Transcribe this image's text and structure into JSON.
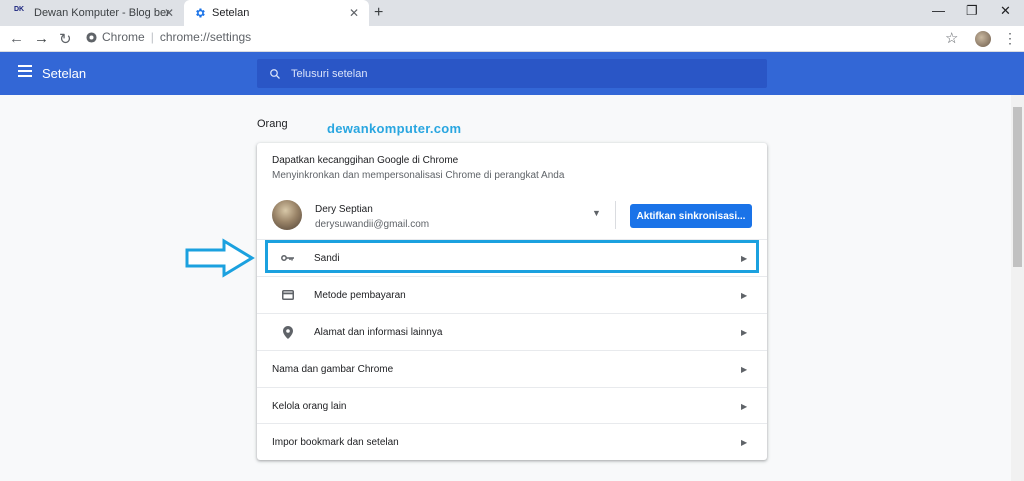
{
  "tabs": [
    {
      "favicon": "DK",
      "title": "Dewan Komputer - Blog berisi tu",
      "close": "✕"
    },
    {
      "favicon": "gear-icon",
      "title": "Setelan",
      "close": "✕"
    }
  ],
  "new_tab": "+",
  "window_controls": {
    "minimize": "—",
    "restore": "❐",
    "close": "✕"
  },
  "toolbar": {
    "back": "←",
    "forward": "→",
    "reload": "↻",
    "site_chip": "Chrome",
    "url": "chrome://settings",
    "star": "☆",
    "menu": "⋮"
  },
  "header": {
    "title": "Setelan",
    "search_placeholder": "Telusuri setelan"
  },
  "section_title": "Orang",
  "watermark": "dewankomputer.com",
  "sync": {
    "title": "Dapatkan kecanggihan Google di Chrome",
    "subtitle": "Menyinkronkan dan mempersonalisasi Chrome di perangkat Anda",
    "name": "Dery Septian",
    "email": "derysuwandii@gmail.com",
    "button": "Aktifkan sinkronisasi..."
  },
  "autofill_rows": [
    {
      "icon": "key-icon",
      "label": "Sandi"
    },
    {
      "icon": "credit-card-icon",
      "label": "Metode pembayaran"
    },
    {
      "icon": "location-pin-icon",
      "label": "Alamat dan informasi lainnya"
    }
  ],
  "people_rows": [
    {
      "label": "Nama dan gambar Chrome"
    },
    {
      "label": "Kelola orang lain"
    },
    {
      "label": "Impor bookmark dan setelan"
    }
  ],
  "colors": {
    "header": "#3367d6",
    "accent": "#1a73e8",
    "highlight": "#1ba1df"
  }
}
